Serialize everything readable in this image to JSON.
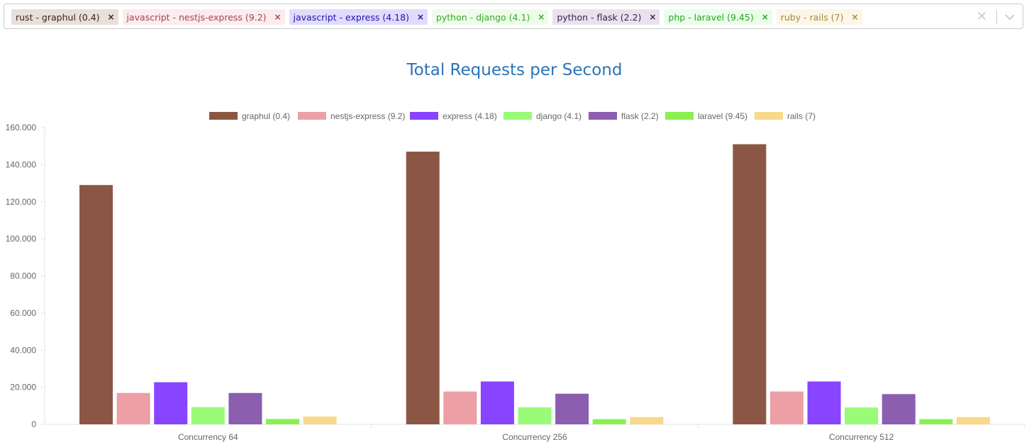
{
  "filters": [
    {
      "label": "rust - graphul (0.4)",
      "bg": "#e8dfd9",
      "fg": "#3b241a"
    },
    {
      "label": "javascript - nestjs-express (9.2)",
      "bg": "#fbecee",
      "fg": "#a3454f"
    },
    {
      "label": "javascript - express (4.18)",
      "bg": "#e0dcfe",
      "fg": "#2212a8"
    },
    {
      "label": "python - django (4.1)",
      "bg": "#eefdea",
      "fg": "#3aa82a"
    },
    {
      "label": "python - flask (2.2)",
      "bg": "#e9e2ee",
      "fg": "#3d2152"
    },
    {
      "label": "php - laravel (9.45)",
      "bg": "#ebfdea",
      "fg": "#25a81f"
    },
    {
      "label": "ruby - rails (7)",
      "bg": "#fdf6e8",
      "fg": "#a38a3d"
    }
  ],
  "icons": {
    "remove": "×",
    "clear": "✕",
    "dropdown": "chevron-down-icon"
  },
  "chart_data": {
    "type": "bar",
    "title": "Total Requests per Second",
    "categories": [
      "Concurrency 64",
      "Concurrency 256",
      "Concurrency 512"
    ],
    "series": [
      {
        "name": "graphul (0.4)",
        "color": "#8b5744",
        "values": [
          129000,
          147000,
          151000
        ]
      },
      {
        "name": "nestjs-express (9.2)",
        "color": "#ec9fa5",
        "values": [
          16900,
          17700,
          17700
        ]
      },
      {
        "name": "express (4.18)",
        "color": "#8844fe",
        "values": [
          22700,
          23100,
          23100
        ]
      },
      {
        "name": "django (4.1)",
        "color": "#99fb78",
        "values": [
          9300,
          9200,
          9100
        ]
      },
      {
        "name": "flask (2.2)",
        "color": "#8b5eaf",
        "values": [
          16900,
          16500,
          16300
        ]
      },
      {
        "name": "laravel (9.45)",
        "color": "#88f14f",
        "values": [
          2900,
          2800,
          2800
        ]
      },
      {
        "name": "rails (7)",
        "color": "#f8d88a",
        "values": [
          4200,
          3900,
          3900
        ]
      }
    ],
    "yticks": [
      "0",
      "20.000",
      "40.000",
      "60.000",
      "80.000",
      "100.000",
      "120.000",
      "140.000",
      "160.000"
    ],
    "ylim": [
      0,
      160000
    ],
    "legend_position": "top",
    "grid": false
  }
}
